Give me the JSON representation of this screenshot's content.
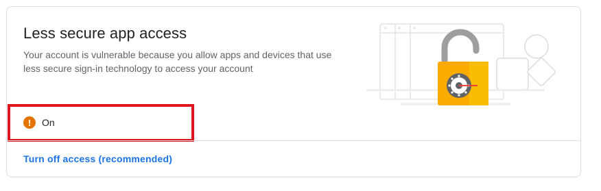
{
  "card": {
    "title": "Less secure app access",
    "description": "Your account is vulnerable because you allow apps and devices that use less secure sign-in technology to access your account"
  },
  "status": {
    "icon": "warning-icon",
    "icon_glyph": "!",
    "label": "On",
    "color": "#e37400"
  },
  "action": {
    "label": "Turn off access (recommended)",
    "color": "#1a73e8"
  },
  "highlight_color": "#e0141f"
}
